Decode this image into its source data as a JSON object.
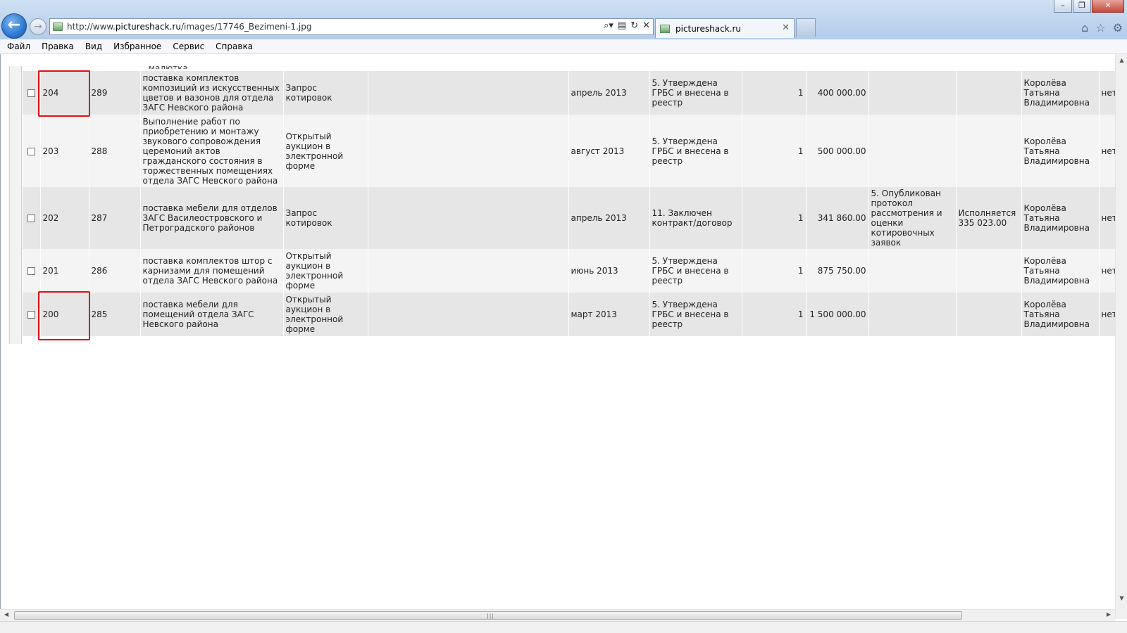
{
  "browser": {
    "url_prefix": "http://www.",
    "url_domain": "pictureshack.ru",
    "url_path": "/images/17746_Bezimeni-1.jpg",
    "tab_title": "pictureshack.ru"
  },
  "menu": [
    "Файл",
    "Правка",
    "Вид",
    "Избранное",
    "Сервис",
    "Справка"
  ],
  "table": {
    "cut_text": "малютка",
    "rows": [
      {
        "id": "204",
        "num": "289",
        "subject": "поставка комплектов композиций из искусственных цветов и вазонов для отдела ЗАГС Невского района",
        "method": "Запрос котировок",
        "blank": "",
        "date": "апрель 2013",
        "status": "5. Утверждена ГРБС и внесена в реестр",
        "qty": "1",
        "amount": "400 000.00",
        "stage": "",
        "exec": "",
        "person": "Королёва Татьяна Владимировна",
        "last": "нет"
      },
      {
        "id": "203",
        "num": "288",
        "subject": "Выполнение работ по приобретению и монтажу звукового сопровождения церемоний актов гражданского состояния в торжественных помещениях отдела ЗАГС Невского района",
        "method": "Открытый аукцион в электронной форме",
        "blank": "",
        "date": "август 2013",
        "status": "5. Утверждена ГРБС и внесена в реестр",
        "qty": "1",
        "amount": "500 000.00",
        "stage": "",
        "exec": "",
        "person": "Королёва Татьяна Владимировна",
        "last": "нет"
      },
      {
        "id": "202",
        "num": "287",
        "subject": "поставка мебели для отделов ЗАГС Василеостровского и Петроградского районов",
        "method": "Запрос котировок",
        "blank": "",
        "date": "апрель 2013",
        "status": "11. Заключен контракт/договор",
        "qty": "1",
        "amount": "341 860.00",
        "stage": "5. Опубликован протокол рассмотрения и оценки котировочных заявок",
        "exec": "Исполняется 335 023.00",
        "person": "Королёва Татьяна Владимировна",
        "last": "нет"
      },
      {
        "id": "201",
        "num": "286",
        "subject": "поставка комплектов штор с карнизами для помещений отдела ЗАГС Невского района",
        "method": "Открытый аукцион в электронной форме",
        "blank": "",
        "date": "июнь 2013",
        "status": "5. Утверждена ГРБС и внесена в реестр",
        "qty": "1",
        "amount": "875 750.00",
        "stage": "",
        "exec": "",
        "person": "Королёва Татьяна Владимировна",
        "last": "нет"
      },
      {
        "id": "200",
        "num": "285",
        "subject": "поставка мебели для помещений отдела ЗАГС Невского района",
        "method": "Открытый аукцион в электронной форме",
        "blank": "",
        "date": "март 2013",
        "status": "5. Утверждена ГРБС и внесена в реестр",
        "qty": "1",
        "amount": "1 500 000.00",
        "stage": "",
        "exec": "",
        "person": "Королёва Татьяна Владимировна",
        "last": "нет"
      }
    ]
  },
  "icons": {
    "back": "arrow-left-icon",
    "forward": "arrow-right-icon",
    "search": "search-icon",
    "refresh": "refresh-icon",
    "stop": "close-icon",
    "home": "home-icon",
    "favorites": "star-icon",
    "tools": "gear-icon"
  },
  "colors": {
    "highlight": "#e01010",
    "row_odd": "#e6e6e6",
    "row_even": "#f4f4f4"
  }
}
